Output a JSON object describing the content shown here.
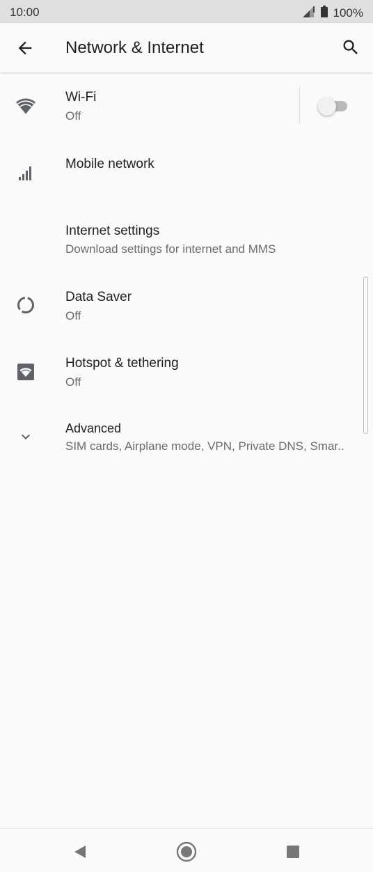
{
  "status_bar": {
    "time": "10:00",
    "battery": "100%",
    "icons": [
      "signal-icon",
      "battery-icon"
    ]
  },
  "app_bar": {
    "title": "Network & Internet",
    "back_icon": "arrow-back-icon",
    "search_icon": "search-icon"
  },
  "items": [
    {
      "title": "Wi-Fi",
      "subtitle": "Off",
      "icon": "wifi-icon",
      "toggle": false
    },
    {
      "title": "Mobile network",
      "subtitle": "",
      "icon": "cellular-signal-icon"
    },
    {
      "title": "Internet settings",
      "subtitle": "Download settings for internet and MMS",
      "icon": ""
    },
    {
      "title": "Data Saver",
      "subtitle": "Off",
      "icon": "data-saver-icon"
    },
    {
      "title": "Hotspot & tethering",
      "subtitle": "Off",
      "icon": "hotspot-icon"
    },
    {
      "title": "Advanced",
      "subtitle": "SIM cards, Airplane mode, VPN, Private DNS, Smar..",
      "icon": "chevron-down-icon"
    }
  ],
  "nav_bar": {
    "icons": [
      "nav-back-icon",
      "nav-home-icon",
      "nav-recents-icon"
    ]
  },
  "colors": {
    "background": "#fafafa",
    "status_bar": "#e0e0e0",
    "primary_text": "#202124",
    "secondary_text": "#6b6b6b",
    "icon": "#5f6368"
  }
}
